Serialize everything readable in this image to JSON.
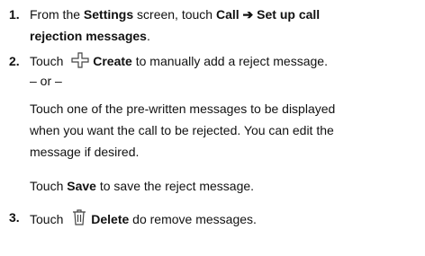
{
  "step1": {
    "number": "1.",
    "prefix": "From the ",
    "settings": "Settings",
    "middle": " screen, touch ",
    "path_part1": "Call ➔ Set up call",
    "path_part2": "rejection messages",
    "end": "."
  },
  "step2": {
    "number": "2.",
    "touch": "Touch ",
    "create_icon": "plus-grid-icon",
    "create": "Create",
    "rest": " to manually add a reject message.",
    "or": "– or –",
    "para_line1": "Touch one of the pre-written messages to be displayed",
    "para_line2": "when you want the call to be rejected. You can edit the",
    "para_line3": "message if desired.",
    "save_prefix": "Touch ",
    "save": "Save",
    "save_rest": " to save the reject message."
  },
  "step3": {
    "number": "3.",
    "touch": "Touch ",
    "delete_icon": "trash-icon",
    "delete": "Delete",
    "rest": " do remove messages."
  }
}
